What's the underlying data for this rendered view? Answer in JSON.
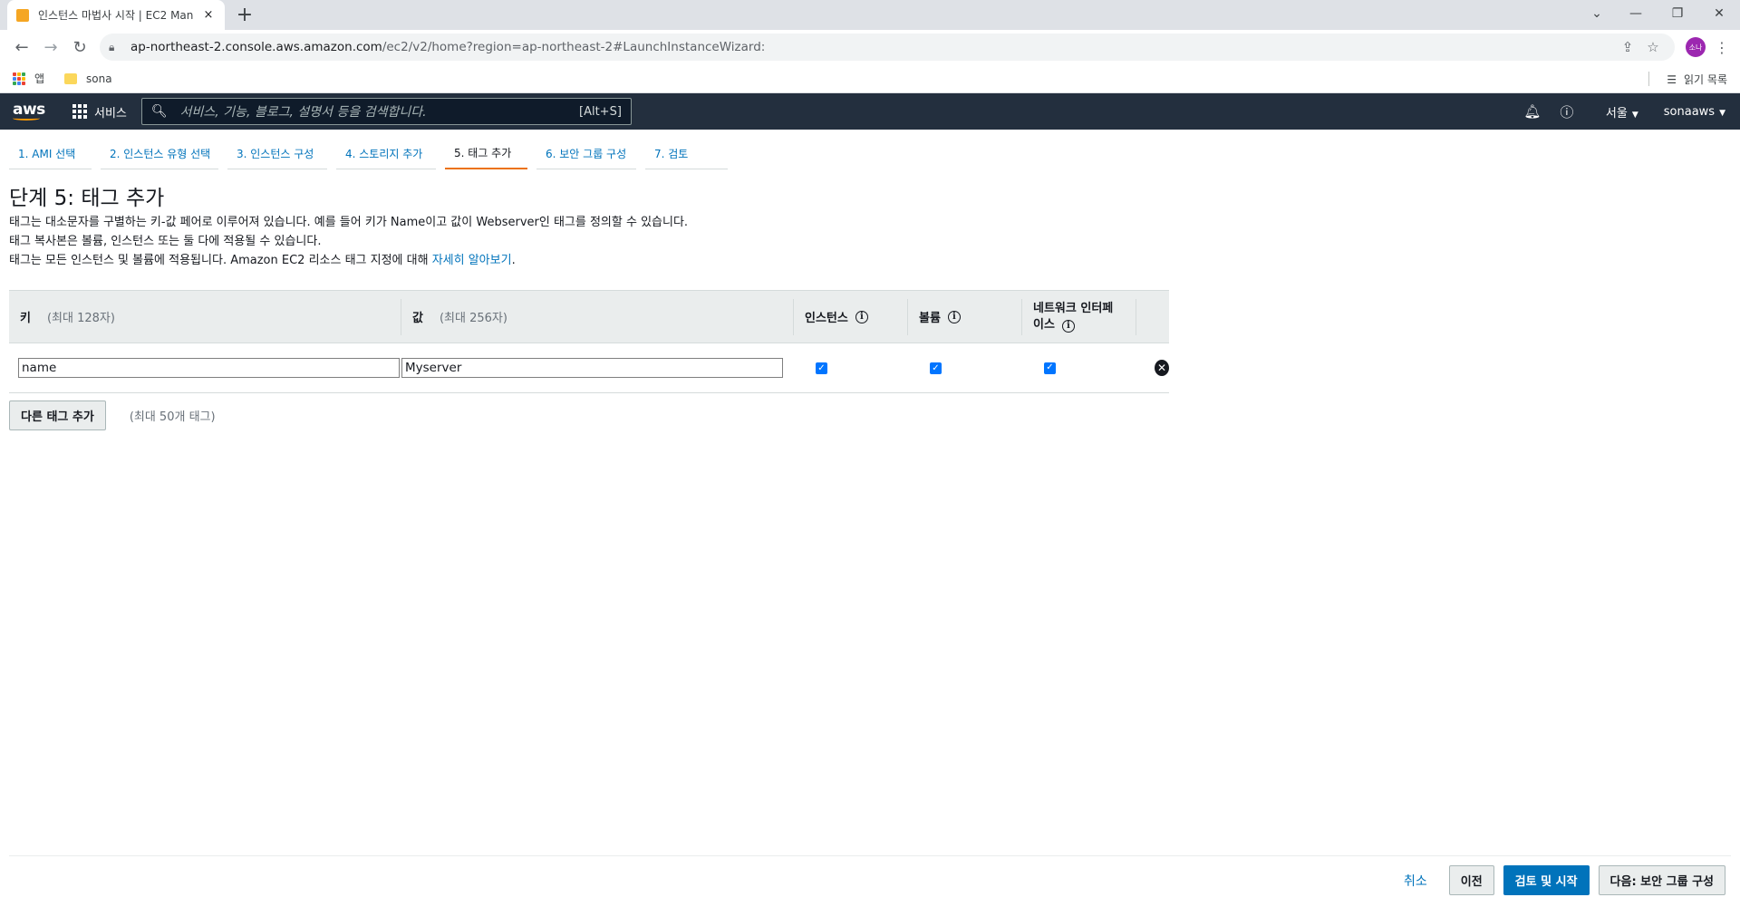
{
  "browser": {
    "tab_title": "인스턴스 마법사 시작 | EC2 Man",
    "tab_close": "×",
    "new_tab": "+",
    "url_host": "ap-northeast-2.console.aws.amazon.com",
    "url_path": "/ec2/v2/home?region=ap-northeast-2#LaunchInstanceWizard:",
    "profile_initials": "소나",
    "bookmarks": [
      {
        "label": "앱"
      },
      {
        "label": "sona"
      }
    ],
    "reading_list": "읽기 목록"
  },
  "aws_header": {
    "logo": "aws",
    "services": "서비스",
    "search_placeholder": "서비스, 기능, 블로그, 설명서 등을 검색합니다.",
    "search_shortcut": "[Alt+S]",
    "region": "서울",
    "account": "sonaaws"
  },
  "steps": [
    {
      "label": "1. AMI 선택",
      "active": false
    },
    {
      "label": "2. 인스턴스 유형 선택",
      "active": false
    },
    {
      "label": "3. 인스턴스 구성",
      "active": false
    },
    {
      "label": "4. 스토리지 추가",
      "active": false
    },
    {
      "label": "5. 태그 추가",
      "active": true
    },
    {
      "label": "6. 보안 그룹 구성",
      "active": false
    },
    {
      "label": "7. 검토",
      "active": false
    }
  ],
  "page": {
    "title": "단계 5: 태그 추가",
    "desc1": "태그는 대소문자를 구별하는 키-값 페어로 이루어져 있습니다. 예를 들어 키가 Name이고 값이 Webserver인 태그를 정의할 수 있습니다.",
    "desc2": "태그 복사본은 볼륨, 인스턴스 또는 둘 다에 적용될 수 있습니다.",
    "desc3": "태그는 모든 인스턴스 및 볼륨에 적용됩니다. Amazon EC2 리소스 태그 지정에 대해 ",
    "learn_more": "자세히 알아보기",
    "desc3_end": "."
  },
  "table": {
    "key_header": "키",
    "key_hint": "(최대 128자)",
    "value_header": "값",
    "value_hint": "(최대 256자)",
    "instance_header": "인스턴스",
    "volume_header": "볼륨",
    "network_header_1": "네트워크 인터페",
    "network_header_2": "이스",
    "rows": [
      {
        "key": "name",
        "value": "Myserver",
        "instance": true,
        "volume": true,
        "network": true
      }
    ],
    "add_button": "다른 태그 추가",
    "add_hint": "(최대 50개 태그)"
  },
  "footer": {
    "cancel": "취소",
    "previous": "이전",
    "review_launch": "검토 및 시작",
    "next": "다음: 보안 그룹 구성"
  },
  "colors": {
    "aws_header_bg": "#232f3e",
    "link": "#0073bb",
    "active_step": "#ec7211",
    "checkbox": "#0075ff"
  }
}
